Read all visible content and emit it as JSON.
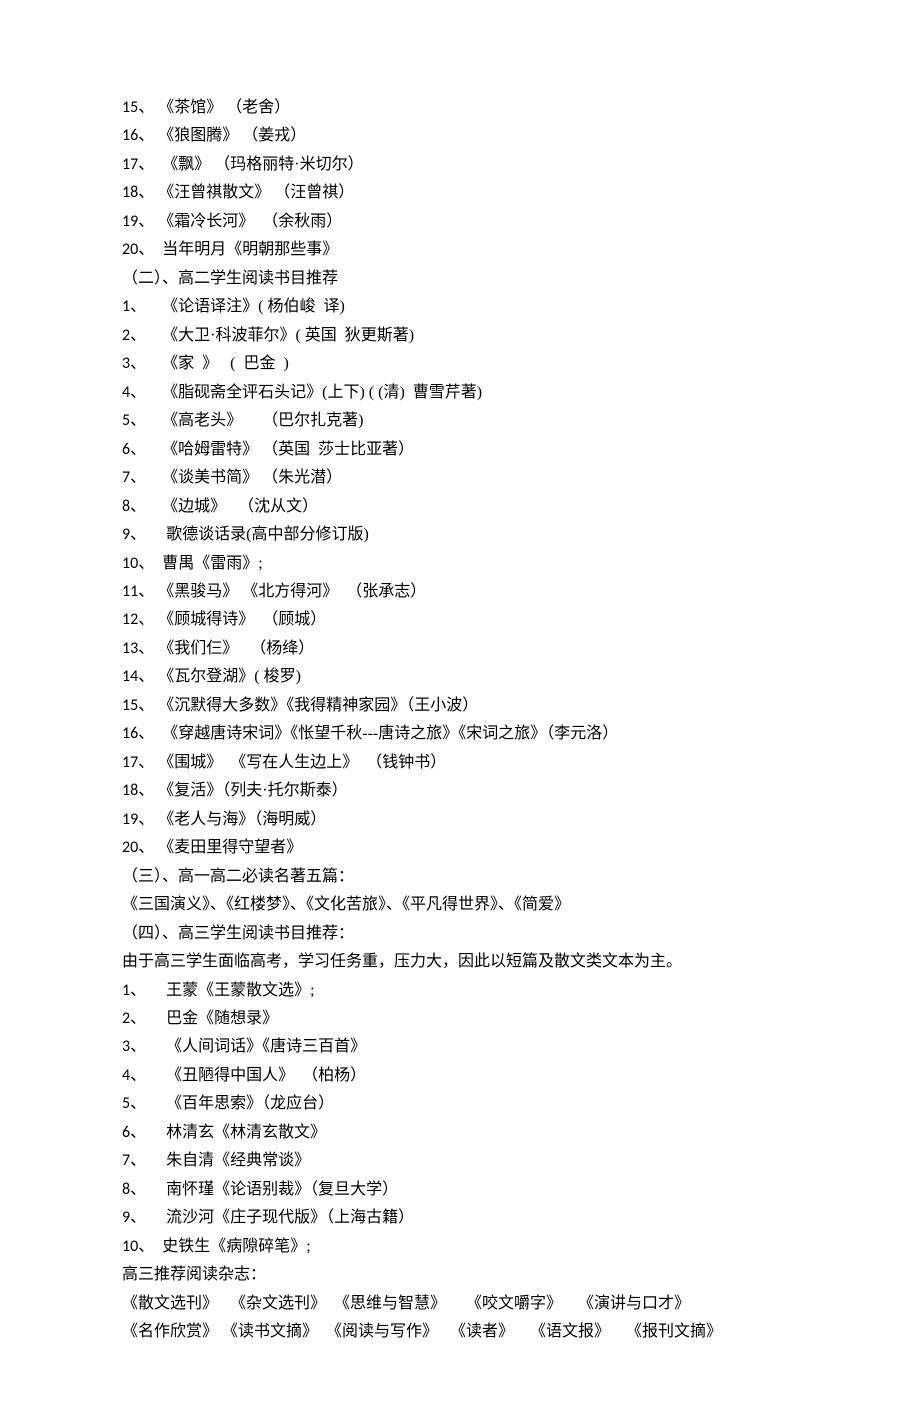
{
  "section1_items": [
    {
      "n": "15",
      "text": "《茶馆》 （老舍）"
    },
    {
      "n": "16",
      "text": "《狼图腾》 （姜戎）"
    },
    {
      "n": "17",
      "text": " 《飘》 （玛格丽特·米切尔）"
    },
    {
      "n": "18",
      "text": "《汪曾祺散文》 （汪曾祺）"
    },
    {
      "n": "19",
      "text": "《霜冷长河》  （余秋雨）"
    },
    {
      "n": "20",
      "text": " 当年明月《明朝那些事》"
    }
  ],
  "section2_title": "（二）、高二学生阅读书目推荐",
  "section2_items": [
    {
      "n": "1",
      "text": "《论语译注》( 杨伯峻  译)"
    },
    {
      "n": "2",
      "text": "《大卫·科波菲尔》( 英国  狄更斯著)"
    },
    {
      "n": "3",
      "text": "《家  》   (  巴金  )"
    },
    {
      "n": "4",
      "text": "《脂砚斋全评石头记》(上下) ( (清)  曹雪芹著)"
    },
    {
      "n": "5",
      "text": "《高老头》     （巴尔扎克著)"
    },
    {
      "n": "6",
      "text": "《哈姆雷特》 （英国  莎士比亚著）"
    },
    {
      "n": "7",
      "text": "《谈美书简》 （朱光潜）"
    },
    {
      "n": "8",
      "text": "《边城》   （沈从文）"
    },
    {
      "n": "9",
      "text": " 歌德谈话录(高中部分修订版)"
    },
    {
      "n": "10",
      "text": " 曹禺《雷雨》;"
    },
    {
      "n": "11",
      "text": "《黑骏马》 《北方得河》  （张承志）"
    },
    {
      "n": "12",
      "text": "《顾城得诗》  （顾城）"
    },
    {
      "n": "13",
      "text": "《我们仨》   （杨绛）"
    },
    {
      "n": "14",
      "text": "《瓦尔登湖》( 梭罗)"
    },
    {
      "n": "15",
      "text": "《沉默得大多数》《我得精神家园》（王小波）"
    },
    {
      "n": "16",
      "text": " 《穿越唐诗宋词》《怅望千秋---唐诗之旅》《宋词之旅》（李元洛）"
    },
    {
      "n": "17",
      "text": "《围城》  《写在人生边上》  （钱钟书）"
    },
    {
      "n": "18",
      "text": "《复活》（列夫·托尔斯泰）"
    },
    {
      "n": "19",
      "text": "《老人与海》（海明威）"
    },
    {
      "n": "20",
      "text": "《麦田里得守望者》"
    }
  ],
  "section3_title": "（三）、高一高二必读名著五篇：",
  "section3_body": "《三国演义》、《红楼梦》、《文化苦旅》、《平凡得世界》、《简爱》",
  "section4_title": "（四）、高三学生阅读书目推荐：",
  "section4_intro": "由于高三学生面临高考，学习任务重，压力大，因此以短篇及散文类文本为主。",
  "section4_items": [
    {
      "n": "1",
      "text": " 王蒙《王蒙散文选》;"
    },
    {
      "n": "2",
      "text": " 巴金《随想录》"
    },
    {
      "n": "3",
      "text": " 《人间词话》《唐诗三百首》"
    },
    {
      "n": "4",
      "text": " 《丑陋得中国人》  （柏杨）"
    },
    {
      "n": "5",
      "text": " 《百年思索》（龙应台）"
    },
    {
      "n": "6",
      "text": " 林清玄《林清玄散文》"
    },
    {
      "n": "7",
      "text": " 朱自清《经典常谈》"
    },
    {
      "n": "8",
      "text": " 南怀瑾《论语别裁》（复旦大学）"
    },
    {
      "n": "9",
      "text": " 流沙河《庄子现代版》（上海古籍）"
    },
    {
      "n": "10",
      "text": " 史铁生《病隙碎笔》;"
    }
  ],
  "mag_title": "高三推荐阅读杂志：",
  "mag_line1": "《散文选刊》   《杂文选刊》  《思维与智慧》     《咬文嚼字》    《演讲与口才》",
  "mag_line2": "《名作欣赏》 《读书文摘》  《阅读与写作》   《读者》    《语文报》    《报刊文摘》"
}
